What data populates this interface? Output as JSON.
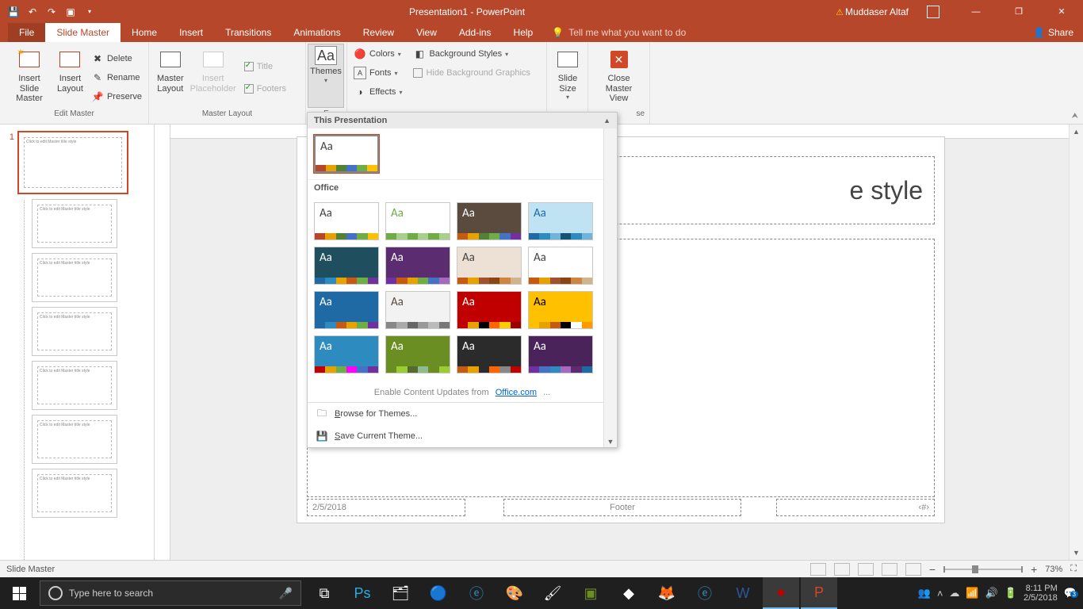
{
  "titlebar": {
    "document_title": "Presentation1 - PowerPoint",
    "user_name": "Muddaser Altaf"
  },
  "tabs": {
    "file": "File",
    "slide_master": "Slide Master",
    "home": "Home",
    "insert": "Insert",
    "transitions": "Transitions",
    "animations": "Animations",
    "review": "Review",
    "view": "View",
    "addins": "Add-ins",
    "help": "Help",
    "tell_me": "Tell me what you want to do",
    "share": "Share"
  },
  "ribbon": {
    "edit_master": {
      "insert_slide_master": "Insert Slide\nMaster",
      "insert_layout": "Insert\nLayout",
      "delete": "Delete",
      "rename": "Rename",
      "preserve": "Preserve",
      "group": "Edit Master"
    },
    "master_layout": {
      "master_layout": "Master\nLayout",
      "insert_placeholder": "Insert\nPlaceholder",
      "title": "Title",
      "footers": "Footers",
      "group": "Master Layout"
    },
    "edit_theme": {
      "themes": "Themes",
      "group": "E"
    },
    "background": {
      "colors": "Colors",
      "fonts": "Fonts",
      "effects": "Effects",
      "bg_styles": "Background Styles",
      "hide_bg": "Hide Background Graphics"
    },
    "size": {
      "slide_size": "Slide\nSize"
    },
    "close": {
      "close_master": "Close\nMaster View",
      "group_partial": "se"
    }
  },
  "themes_panel": {
    "section_this": "This Presentation",
    "section_office": "Office",
    "content_updates_pre": "Enable Content Updates from ",
    "content_updates_link": "Office.com",
    "content_updates_post": "...",
    "browse": "Browse for Themes...",
    "save": "Save Current Theme...",
    "tiles": {
      "this": [
        {
          "aa": "Aa",
          "fg": "#444",
          "bg": "#fff",
          "bar": [
            "#b7472a",
            "#e6a200",
            "#548235",
            "#4472c4",
            "#70ad47",
            "#ffc000"
          ],
          "sel": true
        }
      ],
      "office": [
        {
          "aa": "Aa",
          "fg": "#444",
          "bg": "#fff",
          "bar": [
            "#b7472a",
            "#e6a200",
            "#548235",
            "#4472c4",
            "#70ad47",
            "#ffc000"
          ]
        },
        {
          "aa": "Aa",
          "fg": "#6fac46",
          "bg": "#fff",
          "bar": [
            "#6fac46",
            "#a8d08d",
            "#6fac46",
            "#a8d08d",
            "#6fac46",
            "#a8d08d"
          ],
          "accent": "#6fac46"
        },
        {
          "aa": "Aa",
          "fg": "#fff",
          "bg": "#5b4a3e",
          "bar": [
            "#c55a11",
            "#e6a200",
            "#548235",
            "#70ad47",
            "#4472c4",
            "#7030a0"
          ]
        },
        {
          "aa": "Aa",
          "fg": "#1f6aa5",
          "bg": "#bfe3f2",
          "bar": [
            "#1f6aa5",
            "#2e8bc0",
            "#6eb5d9",
            "#145374",
            "#2e8bc0",
            "#6eb5d9"
          ],
          "pattern": true
        },
        {
          "aa": "Aa",
          "fg": "#fff",
          "bg": "#1f4e5f",
          "bar": [
            "#1f6aa5",
            "#2e8bc0",
            "#e6a200",
            "#c55a11",
            "#70ad47",
            "#7030a0"
          ]
        },
        {
          "aa": "Aa",
          "fg": "#fff",
          "bg": "#5b2c6f",
          "bar": [
            "#7030a0",
            "#c55a11",
            "#e6a200",
            "#70ad47",
            "#4472c4",
            "#a569bd"
          ]
        },
        {
          "aa": "Aa",
          "fg": "#444",
          "bg": "#ede0d4",
          "bar": [
            "#c55a11",
            "#e6a200",
            "#a0522d",
            "#8b4513",
            "#cd853f",
            "#d2b48c"
          ]
        },
        {
          "aa": "Aa",
          "fg": "#444",
          "bg": "#fff",
          "bar": [
            "#c55a11",
            "#e6a200",
            "#a0522d",
            "#8b4513",
            "#cd853f",
            "#d2b48c"
          ]
        },
        {
          "aa": "Aa",
          "fg": "#fff",
          "bg": "#1f6aa5",
          "bar": [
            "#1f6aa5",
            "#2e8bc0",
            "#c55a11",
            "#e6a200",
            "#70ad47",
            "#7030a0"
          ]
        },
        {
          "aa": "Aa",
          "fg": "#5b4a3e",
          "bg": "#f2f2f2",
          "bar": [
            "#888",
            "#aaa",
            "#666",
            "#999",
            "#bbb",
            "#777"
          ]
        },
        {
          "aa": "Aa",
          "fg": "#fff",
          "bg": "#c00000",
          "bar": [
            "#c00000",
            "#e6a200",
            "#000",
            "#ff6600",
            "#ffcc00",
            "#990000"
          ]
        },
        {
          "aa": "Aa",
          "fg": "#000",
          "bg": "#ffc000",
          "bar": [
            "#ffc000",
            "#e6a200",
            "#c55a11",
            "#000",
            "#fff",
            "#ff9900"
          ]
        },
        {
          "aa": "Aa",
          "fg": "#fff",
          "bg": "#2e8bc0",
          "bar": [
            "#c00000",
            "#e6a200",
            "#70ad47",
            "#ff00ff",
            "#4472c4",
            "#7030a0"
          ],
          "topbar": "#2e8bc0"
        },
        {
          "aa": "Aa",
          "fg": "#fff",
          "bg": "#6b8e23",
          "bar": [
            "#6b8e23",
            "#9acd32",
            "#556b2f",
            "#8fbc8f",
            "#6b8e23",
            "#9acd32"
          ]
        },
        {
          "aa": "Aa",
          "fg": "#fff",
          "bg": "#2b2b2b",
          "bar": [
            "#c55a11",
            "#e6a200",
            "#2b2b2b",
            "#ff6600",
            "#888",
            "#c00000"
          ],
          "stripe": true
        },
        {
          "aa": "Aa",
          "fg": "#fff",
          "bg": "#4a235a",
          "bar": [
            "#7030a0",
            "#4472c4",
            "#2e8bc0",
            "#a569bd",
            "#5b2c6f",
            "#1f6aa5"
          ]
        }
      ]
    }
  },
  "slide": {
    "title_visible_fragment": "e style",
    "date": "2/5/2018",
    "footer": "Footer",
    "number": "‹#›"
  },
  "thumbs": {
    "master_num": "1",
    "master_text": "Click to edit Master title style",
    "layout_text": "Click to edit Master title style"
  },
  "statusbar": {
    "mode": "Slide Master",
    "zoom": "73%"
  },
  "taskbar": {
    "search_placeholder": "Type here to search",
    "time": "8:11 PM",
    "date": "2/5/2018",
    "action_badge": "3"
  }
}
